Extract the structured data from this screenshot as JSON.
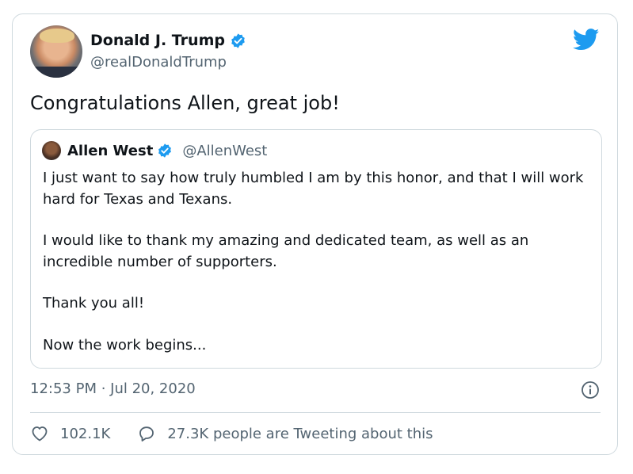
{
  "tweet": {
    "author_name": "Donald J. Trump",
    "author_handle": "@realDonaldTrump",
    "text": "Congratulations Allen, great job!",
    "timestamp": "12:53 PM · Jul 20, 2020",
    "likes": "102.1K",
    "retweet_text": "27.3K people are Tweeting about this"
  },
  "quoted_tweet": {
    "author_name": "Allen West",
    "author_handle": "@AllenWest",
    "paragraphs": [
      "I just want to say how truly humbled I am by this honor, and that I will work hard for Texas and Texans.",
      "I would like to thank my amazing and dedicated team, as well as an incredible number of supporters.",
      "Thank you all!",
      "Now the work begins..."
    ]
  },
  "icons": {
    "verified": "verified-badge-icon",
    "brand": "twitter-bird-icon",
    "info": "info-icon",
    "like": "heart-icon",
    "reply": "speech-bubble-icon"
  },
  "colors": {
    "twitter_blue": "#1d9bf0",
    "secondary_text": "#536471",
    "border": "#cfd9de"
  }
}
